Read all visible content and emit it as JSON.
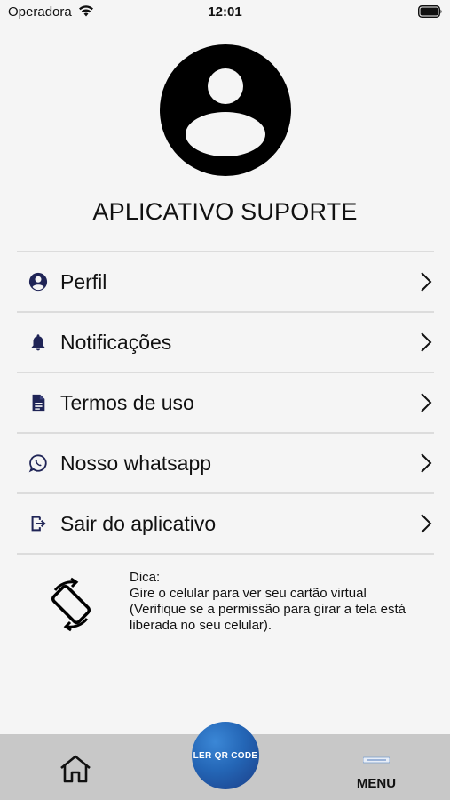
{
  "status_bar": {
    "carrier": "Operadora",
    "time": "12:01"
  },
  "app_title": "APLICATIVO SUPORTE",
  "menu": {
    "items": [
      {
        "label": "Perfil",
        "icon": "account-circle-icon"
      },
      {
        "label": "Notificações",
        "icon": "bell-icon"
      },
      {
        "label": "Termos de uso",
        "icon": "document-icon"
      },
      {
        "label": "Nosso whatsapp",
        "icon": "whatsapp-icon"
      },
      {
        "label": "Sair do aplicativo",
        "icon": "logout-icon"
      }
    ]
  },
  "tip": {
    "line1": "Dica:",
    "line2": "Gire o celular para ver seu cartão virtual",
    "line3": "(Verifique se a permissão para girar a tela está",
    "line4": "liberada no seu celular)."
  },
  "bottom_nav": {
    "qr_label": "LER QR CODE",
    "menu_label": "MENU"
  },
  "colors": {
    "icon": "#1f2456",
    "qr_button": "#2466b6",
    "bottom_nav_bg": "#c8c8c8"
  }
}
